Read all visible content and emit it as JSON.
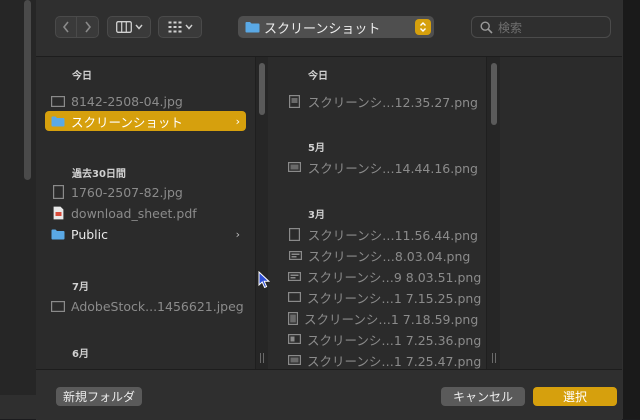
{
  "toolbar": {
    "location_label": "スクリーンショット",
    "search_placeholder": "検索"
  },
  "column1": {
    "sections": [
      "今日",
      "過去30日間",
      "7月",
      "6月"
    ],
    "items": [
      {
        "label": "8142-2508-04.jpg",
        "icon": "image-file-icon"
      },
      {
        "label": "スクリーンショット",
        "icon": "folder-icon",
        "selected": true
      },
      {
        "label": "1760-2507-82.jpg",
        "icon": "image-file-icon"
      },
      {
        "label": "download_sheet.pdf",
        "icon": "pdf-file-icon"
      },
      {
        "label": "Public",
        "icon": "folder-icon"
      },
      {
        "label": "AdobeStock...1456621.jpeg",
        "icon": "image-file-icon"
      }
    ]
  },
  "column2": {
    "sections": [
      "今日",
      "5月",
      "3月"
    ],
    "items": [
      {
        "label": "スクリーンシ…12.35.27.png"
      },
      {
        "label": "スクリーンシ…14.44.16.png"
      },
      {
        "label": "スクリーンシ…11.56.44.png"
      },
      {
        "label": "スクリーンシ…8.03.04.png"
      },
      {
        "label": "スクリーンシ…9 8.03.51.png"
      },
      {
        "label": "スクリーンシ…1 7.15.25.png"
      },
      {
        "label": "スクリーンシ…1 7.18.59.png"
      },
      {
        "label": "スクリーンシ…1 7.25.36.png"
      },
      {
        "label": "スクリーンシ…1 7.25.47.png"
      }
    ]
  },
  "footer": {
    "new_folder": "新規フォルダ",
    "cancel": "キャンセル",
    "choose": "選択"
  },
  "colors": {
    "accent": "#d6a00d",
    "folder_blue": "#5aa9e6",
    "background": "#2b2b2b"
  }
}
